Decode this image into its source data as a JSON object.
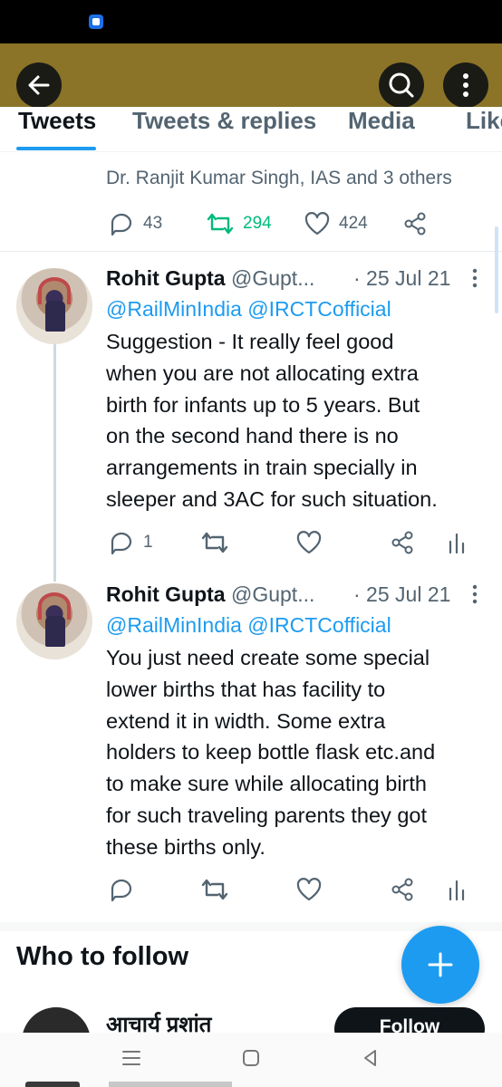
{
  "header": {
    "back_icon": "arrow-left-icon",
    "search_icon": "search-icon",
    "more_icon": "more-vertical-icon",
    "bar_color": "#8b7428"
  },
  "tabs": [
    {
      "label": "Tweets",
      "active": true
    },
    {
      "label": "Tweets & replies",
      "active": false
    },
    {
      "label": "Media",
      "active": false
    },
    {
      "label": "Likes",
      "active": false
    }
  ],
  "top_tweet": {
    "liked_by": "Dr. Ranjit Kumar Singh, IAS and 3 others",
    "replies": "43",
    "retweets": "294",
    "likes": "424"
  },
  "tweets": [
    {
      "name": "Rohit Gupta",
      "handle": "@Gupt...",
      "date": "· 25 Jul 21",
      "mentions": "@RailMinIndia @IRCTCofficial",
      "text": "Suggestion - It really feel good\nwhen you are not allocating extra\nbirth for infants up to 5 years. But\non the second hand there is no\narrangements in train specially in\nsleeper and 3AC for such situation.",
      "replies": "1"
    },
    {
      "name": "Rohit Gupta",
      "handle": "@Gupt...",
      "date": "· 25 Jul 21",
      "mentions": "@RailMinIndia @IRCTCofficial",
      "text": "You just need create some special\nlower births that has facility to\nextend it in width. Some extra\nholders to keep bottle flask etc.and\nto make sure while allocating birth\nfor such traveling parents they got\nthese births only.",
      "replies": ""
    }
  ],
  "who_to_follow": {
    "title": "Who to follow",
    "first_name": "आचार्य प्रशांत",
    "follow_label": "Follow"
  },
  "colors": {
    "accent": "#1d9bf0",
    "retweet_green": "#00ba7c",
    "secondary_text": "#536471"
  }
}
